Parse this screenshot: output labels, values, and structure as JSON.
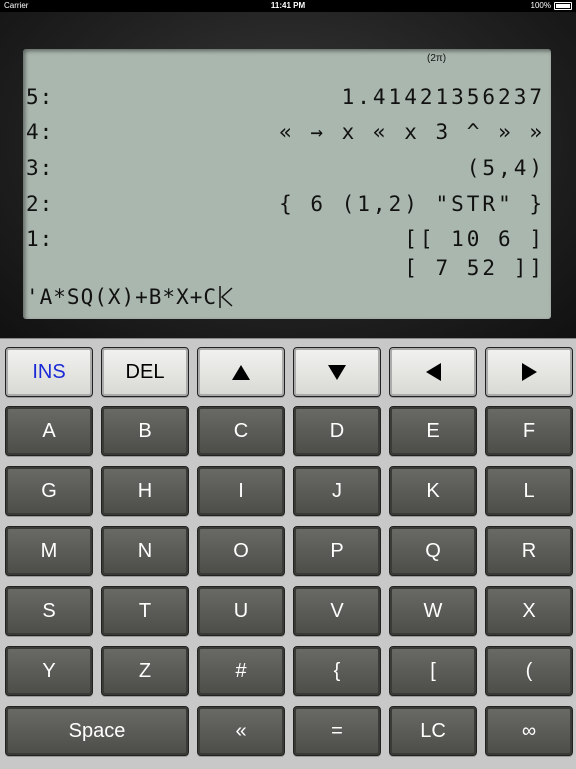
{
  "status_bar": {
    "carrier": "Carrier",
    "time": "11:41 PM",
    "battery": "100%"
  },
  "display": {
    "annunciator": "(2π)",
    "stack": [
      {
        "level": "5:",
        "value": "1.41421356237"
      },
      {
        "level": "4:",
        "value": "« → x « x 3 ^ » »"
      },
      {
        "level": "3:",
        "value": "(5,4)"
      },
      {
        "level": "2:",
        "value": "{ 6 (1,2) \"STR\" }"
      },
      {
        "level": "1:",
        "value": "[[ 10 6 ]",
        "value2": "[ 7 52 ]]"
      }
    ],
    "command_line": "'A*SQ(X)+B*X+C",
    "cursor_icon": "insert-cursor-icon"
  },
  "keys": {
    "ins": "INS",
    "del": "DEL",
    "up": "up-arrow-icon",
    "down": "down-arrow-icon",
    "left": "left-arrow-icon",
    "right": "right-arrow-icon",
    "letters": [
      "A",
      "B",
      "C",
      "D",
      "E",
      "F",
      "G",
      "H",
      "I",
      "J",
      "K",
      "L",
      "M",
      "N",
      "O",
      "P",
      "Q",
      "R",
      "S",
      "T",
      "U",
      "V",
      "W",
      "X"
    ],
    "row6": [
      "Y",
      "Z",
      "#",
      "{",
      "[",
      "("
    ],
    "space": "Space",
    "prog": "«",
    "equals": "=",
    "lc": "LC",
    "infinity": "∞"
  },
  "colors": {
    "lcd": "#aab7ae",
    "ins_text": "#1a2bd6",
    "dark_key": "#5a5a56",
    "light_key": "#e6e6e3"
  }
}
